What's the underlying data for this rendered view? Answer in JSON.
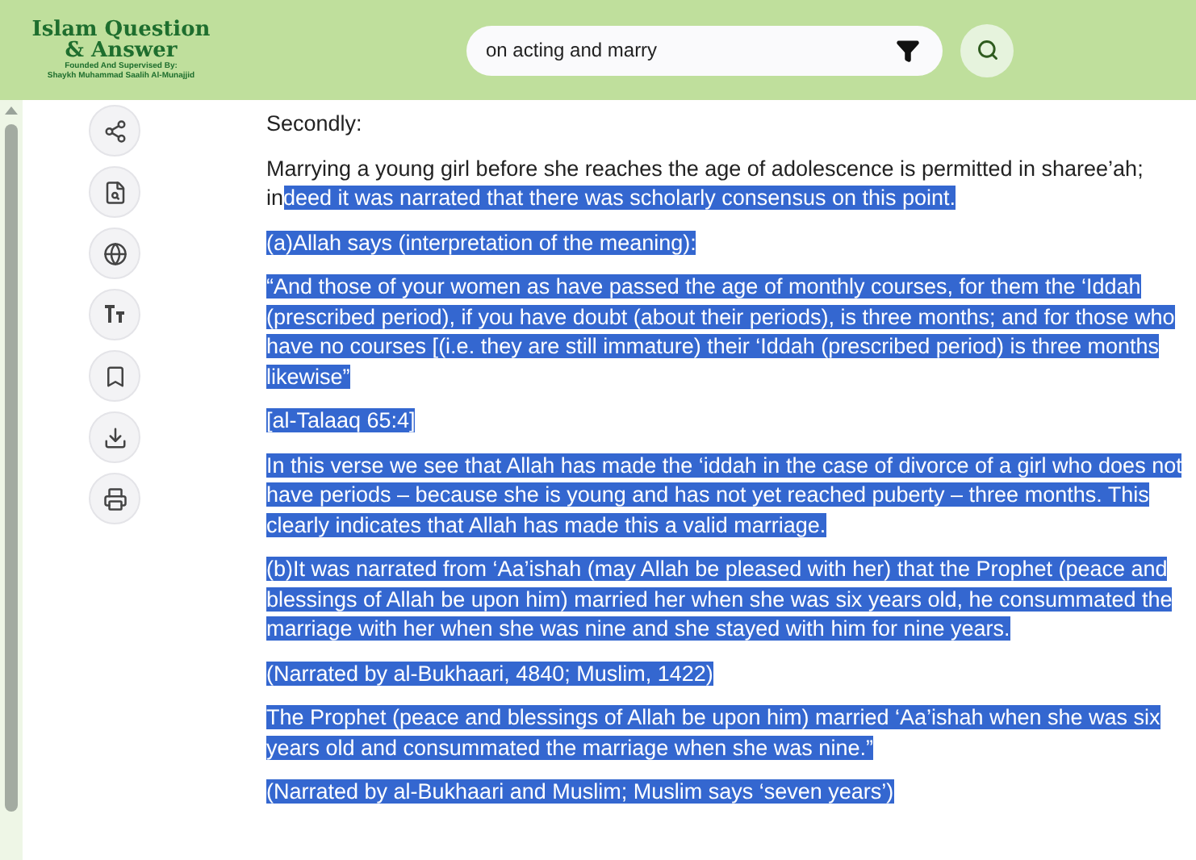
{
  "logo": {
    "title_lines": [
      "Islam Question",
      "& Answer"
    ],
    "subtitle_lines": [
      "Founded And Supervised By:",
      "Shaykh Muhammad Saalih Al-Munajjid"
    ]
  },
  "search": {
    "value": "on acting and marry"
  },
  "tools": [
    {
      "kind": "share"
    },
    {
      "kind": "doc-search"
    },
    {
      "kind": "globe"
    },
    {
      "kind": "text-size"
    },
    {
      "kind": "bookmark"
    },
    {
      "kind": "download"
    },
    {
      "kind": "print"
    }
  ],
  "paragraphs": [
    {
      "segments": [
        {
          "text": "Secondly:",
          "selected": false
        }
      ]
    },
    {
      "segments": [
        {
          "text": "Marrying a young girl before she reaches the age of adolescence is permitted in sharee’ah; in",
          "selected": false
        },
        {
          "text": "deed it was narrated that there was scholarly consensus on this point.",
          "selected": true
        }
      ]
    },
    {
      "segments": [
        {
          "text": "(a)Allah says (interpretation of the meaning):",
          "selected": true
        }
      ]
    },
    {
      "segments": [
        {
          "text": "“And those of your women as have passed the age of monthly courses, for them the ‘Iddah (prescribed period), if you have doubt (about their periods), is three months; and for those who have no courses [(i.e. they are still immature) their ‘Iddah (prescribed period) is three months likewise”",
          "selected": true
        }
      ]
    },
    {
      "segments": [
        {
          "text": "[al-Talaaq 65:4]",
          "selected": true
        }
      ]
    },
    {
      "segments": [
        {
          "text": "In this verse we see that Allah has made the ‘iddah in the case of divorce of a girl who does not have periods – because she is young and has not yet reached puberty – three months. This clearly indicates that Allah has made this a valid marriage.",
          "selected": true
        }
      ]
    },
    {
      "segments": [
        {
          "text": "(b)It was narrated from ‘Aa’ishah (may Allah be pleased with her) that the Prophet (peace and blessings of Allah be upon him) married her when she was six years old, he consummated the marriage with her when she was nine and she stayed with him for nine years.",
          "selected": true
        }
      ]
    },
    {
      "segments": [
        {
          "text": "(Narrated by al-Bukhaari, 4840; Muslim, 1422)",
          "selected": true
        }
      ]
    },
    {
      "segments": [
        {
          "text": "The Prophet (peace and blessings of Allah be upon him) married ‘Aa’ishah when she was six years old and consummated the marriage when she was nine.”",
          "selected": true
        }
      ]
    },
    {
      "segments": [
        {
          "text": "(Narrated by al-Bukhaari and Muslim; Muslim says ‘seven years’)",
          "selected": true
        }
      ]
    }
  ]
}
